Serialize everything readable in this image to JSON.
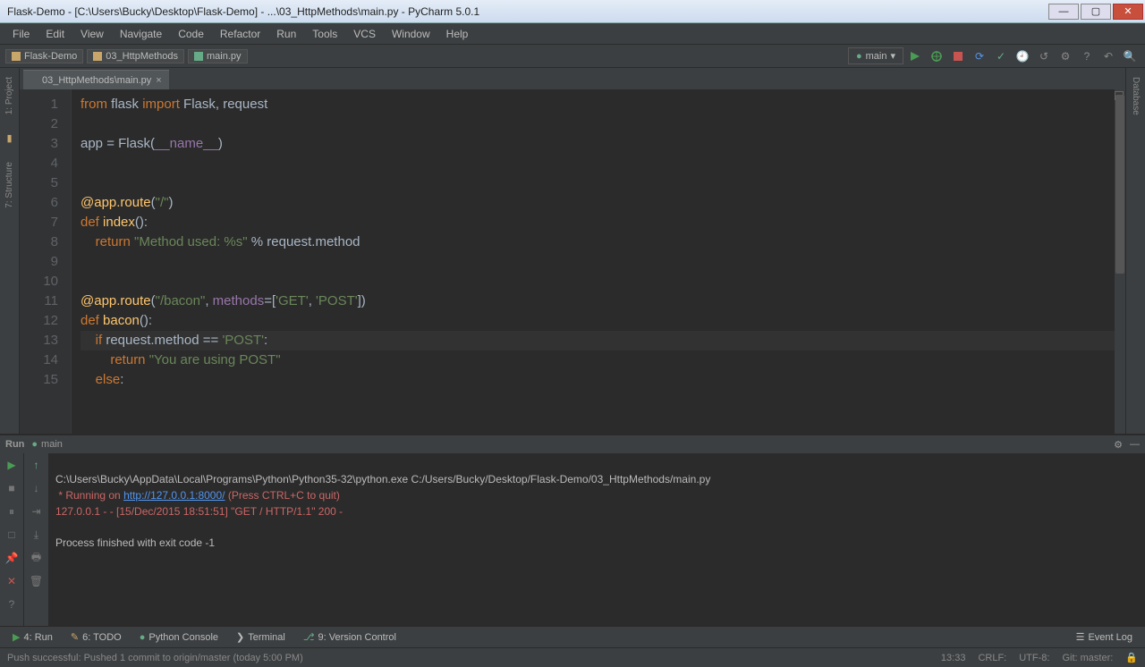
{
  "window": {
    "title": "Flask-Demo - [C:\\Users\\Bucky\\Desktop\\Flask-Demo] - ...\\03_HttpMethods\\main.py - PyCharm 5.0.1"
  },
  "menu": [
    "File",
    "Edit",
    "View",
    "Navigate",
    "Code",
    "Refactor",
    "Run",
    "Tools",
    "VCS",
    "Window",
    "Help"
  ],
  "breadcrumbs": [
    "Flask-Demo",
    "03_HttpMethods",
    "main.py"
  ],
  "run_config": "main",
  "tab": {
    "label": "03_HttpMethods\\main.py"
  },
  "left_tools": [
    "1: Project",
    "7: Structure"
  ],
  "right_tools": [
    "Database"
  ],
  "code": {
    "lines": [
      {
        "n": 1,
        "seg": [
          [
            "k-orange",
            "from "
          ],
          [
            "k-white",
            "flask "
          ],
          [
            "k-orange",
            "import "
          ],
          [
            "k-white",
            "Flask, request"
          ]
        ]
      },
      {
        "n": 2,
        "seg": []
      },
      {
        "n": 3,
        "seg": [
          [
            "k-white",
            "app = Flask("
          ],
          [
            "k-purple",
            "__name__"
          ],
          [
            "k-white",
            ")"
          ]
        ]
      },
      {
        "n": 4,
        "seg": []
      },
      {
        "n": 5,
        "seg": []
      },
      {
        "n": 6,
        "seg": [
          [
            "k-yellow",
            "@app.route"
          ],
          [
            "k-white",
            "("
          ],
          [
            "k-green",
            "\"/\""
          ],
          [
            "k-white",
            ")"
          ]
        ]
      },
      {
        "n": 7,
        "seg": [
          [
            "k-orange",
            "def "
          ],
          [
            "k-yellow",
            "index"
          ],
          [
            "k-white",
            "():"
          ]
        ]
      },
      {
        "n": 8,
        "seg": [
          [
            "k-white",
            "    "
          ],
          [
            "k-orange",
            "return "
          ],
          [
            "k-green",
            "\"Method used: %s\""
          ],
          [
            "k-white",
            " % request.method"
          ]
        ]
      },
      {
        "n": 9,
        "seg": []
      },
      {
        "n": 10,
        "seg": []
      },
      {
        "n": 11,
        "seg": [
          [
            "k-yellow",
            "@app.route"
          ],
          [
            "k-white",
            "("
          ],
          [
            "k-green",
            "\"/bacon\""
          ],
          [
            "k-white",
            ", "
          ],
          [
            "k-purple",
            "methods"
          ],
          [
            "k-white",
            "=["
          ],
          [
            "k-green",
            "'GET'"
          ],
          [
            "k-white",
            ", "
          ],
          [
            "k-green",
            "'POST'"
          ],
          [
            "k-white",
            "])"
          ]
        ]
      },
      {
        "n": 12,
        "seg": [
          [
            "k-orange",
            "def "
          ],
          [
            "k-yellow",
            "bacon"
          ],
          [
            "k-white",
            "():"
          ]
        ]
      },
      {
        "n": 13,
        "seg": [
          [
            "k-white",
            "    "
          ],
          [
            "k-orange",
            "if "
          ],
          [
            "k-white",
            "request.method == "
          ],
          [
            "k-green",
            "'POST'"
          ],
          [
            "k-white",
            ":"
          ]
        ],
        "hl": true
      },
      {
        "n": 14,
        "seg": [
          [
            "k-white",
            "        "
          ],
          [
            "k-orange",
            "return "
          ],
          [
            "k-green",
            "\"You are using POST\""
          ]
        ]
      },
      {
        "n": 15,
        "seg": [
          [
            "k-white",
            "    "
          ],
          [
            "k-orange",
            "else"
          ],
          [
            "k-white",
            ":"
          ]
        ]
      }
    ]
  },
  "run": {
    "header_label": "Run",
    "header_config": "main",
    "output": {
      "cmd": "C:\\Users\\Bucky\\AppData\\Local\\Programs\\Python\\Python35-32\\python.exe C:/Users/Bucky/Desktop/Flask-Demo/03_HttpMethods/main.py",
      "running_prefix": " * Running on ",
      "running_url": "http://127.0.0.1:8000/",
      "running_suffix": " (Press CTRL+C to quit)",
      "log_line": "127.0.0.1 - - [15/Dec/2015 18:51:51] \"GET / HTTP/1.1\" 200 -",
      "exit": "Process finished with exit code -1"
    }
  },
  "bottom_tabs": {
    "run": "4: Run",
    "todo": "6: TODO",
    "pyconsole": "Python Console",
    "terminal": "Terminal",
    "vcs": "9: Version Control",
    "eventlog": "Event Log"
  },
  "status": {
    "msg": "Push successful: Pushed 1 commit to origin/master (today 5:00 PM)",
    "pos": "13:33",
    "crlf": "CRLF:",
    "enc": "UTF-8:",
    "git": "Git: master:"
  }
}
